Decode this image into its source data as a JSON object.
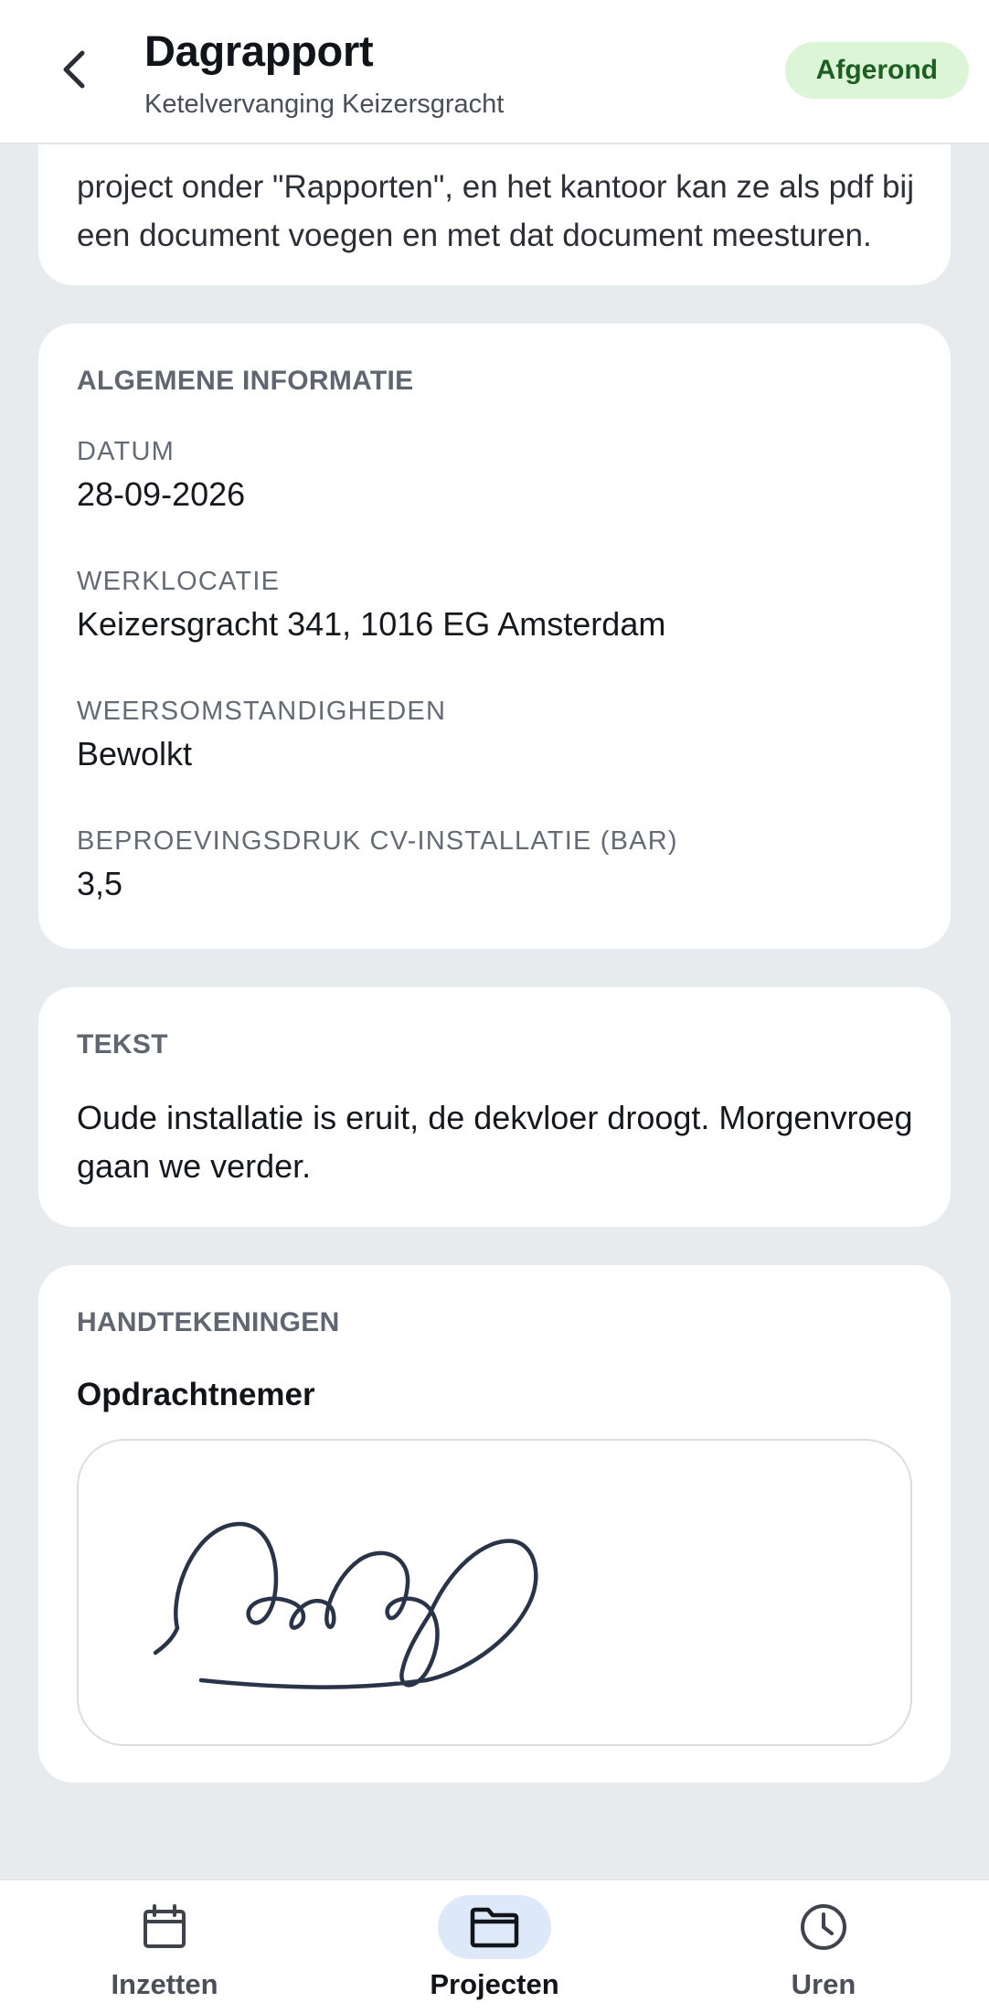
{
  "header": {
    "title": "Dagrapport",
    "subtitle": "Ketelvervanging Keizersgracht",
    "status": "Afgerond"
  },
  "intro": {
    "text": "project onder \"Rapporten\", en het kantoor kan ze als pdf bij een document voegen en met dat document meesturen."
  },
  "general_info": {
    "title": "ALGEMENE INFORMATIE",
    "fields": [
      {
        "label": "DATUM",
        "value": "28-09-2026"
      },
      {
        "label": "WERKLOCATIE",
        "value": "Keizersgracht 341, 1016 EG Amsterdam"
      },
      {
        "label": "WEERSOMSTANDIGHEDEN",
        "value": "Bewolkt"
      },
      {
        "label": "BEPROEVINGSDRUK CV-INSTALLATIE (BAR)",
        "value": "3,5"
      }
    ]
  },
  "text_section": {
    "title": "TEKST",
    "body": "Oude installatie is eruit, de dekvloer droogt. Morgenvroeg gaan we verder."
  },
  "signatures": {
    "title": "HANDTEKENINGEN",
    "signer": "Opdrachtnemer"
  },
  "nav": {
    "items": [
      {
        "label": "Inzetten",
        "icon": "calendar-icon"
      },
      {
        "label": "Projecten",
        "icon": "folder-icon"
      },
      {
        "label": "Uren",
        "icon": "clock-icon"
      }
    ],
    "active": "Projecten"
  },
  "colors": {
    "badge_bg": "#dcf5d6",
    "badge_text": "#1e5e22",
    "nav_active_bg": "#dde9f8",
    "page_bg": "#e8ebee"
  }
}
